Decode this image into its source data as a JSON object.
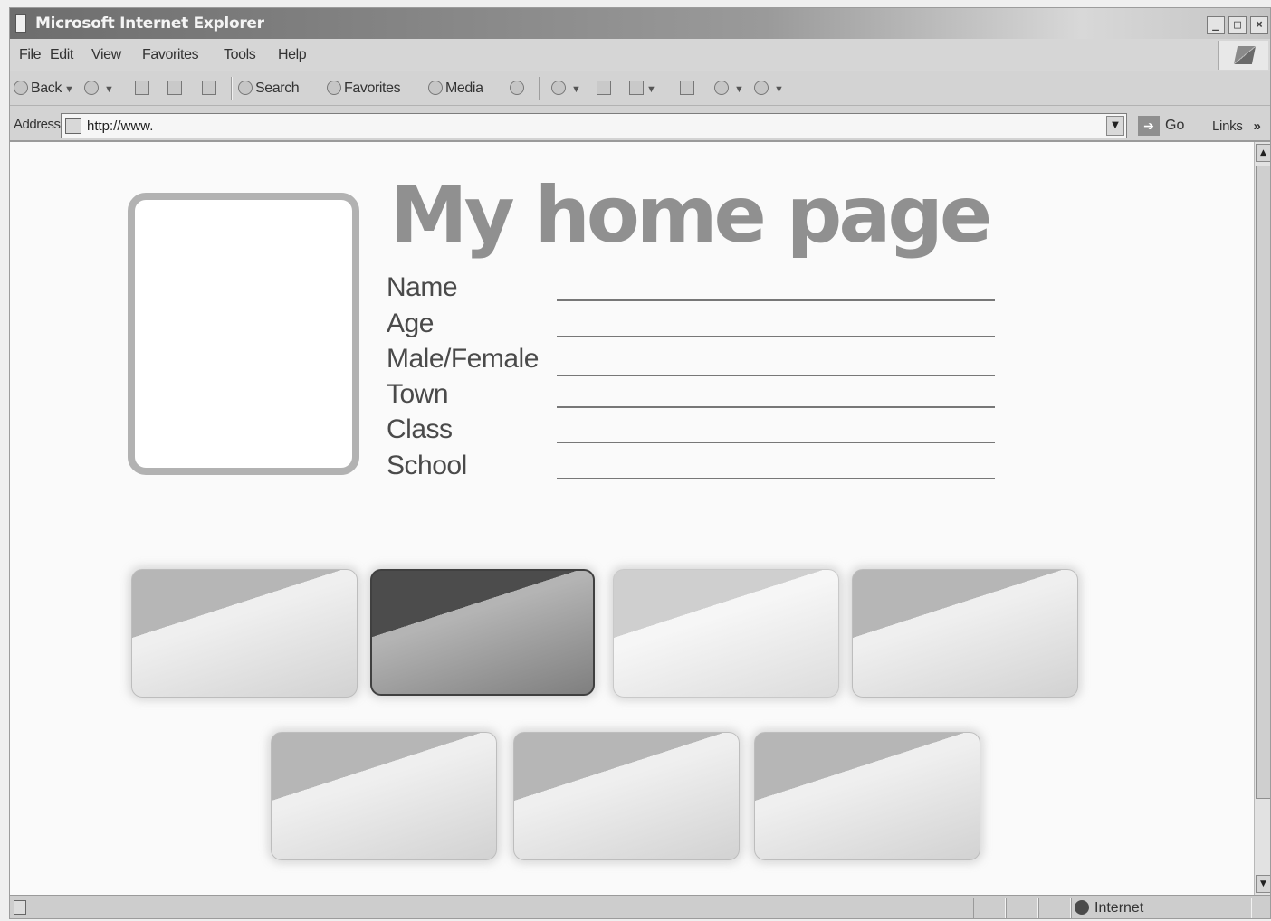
{
  "window": {
    "title": "Microsoft Internet Explorer",
    "controls": [
      "_",
      "□",
      "×"
    ]
  },
  "menu": [
    "File",
    "Edit",
    "View",
    "Favorites",
    "Tools",
    "Help"
  ],
  "toolbar": {
    "back": "Back",
    "search": "Search",
    "favorites": "Favorites",
    "media": "Media"
  },
  "address": {
    "label": "Address",
    "value": "http://www.",
    "go": "Go",
    "links": "Links",
    "chevron": "»"
  },
  "page": {
    "title": "My home page",
    "fields": [
      {
        "label": "Name"
      },
      {
        "label": "Age"
      },
      {
        "label": "Male/Female"
      },
      {
        "label": "Town"
      },
      {
        "label": "Class"
      },
      {
        "label": "School"
      }
    ]
  },
  "status": {
    "zone": "Internet"
  }
}
